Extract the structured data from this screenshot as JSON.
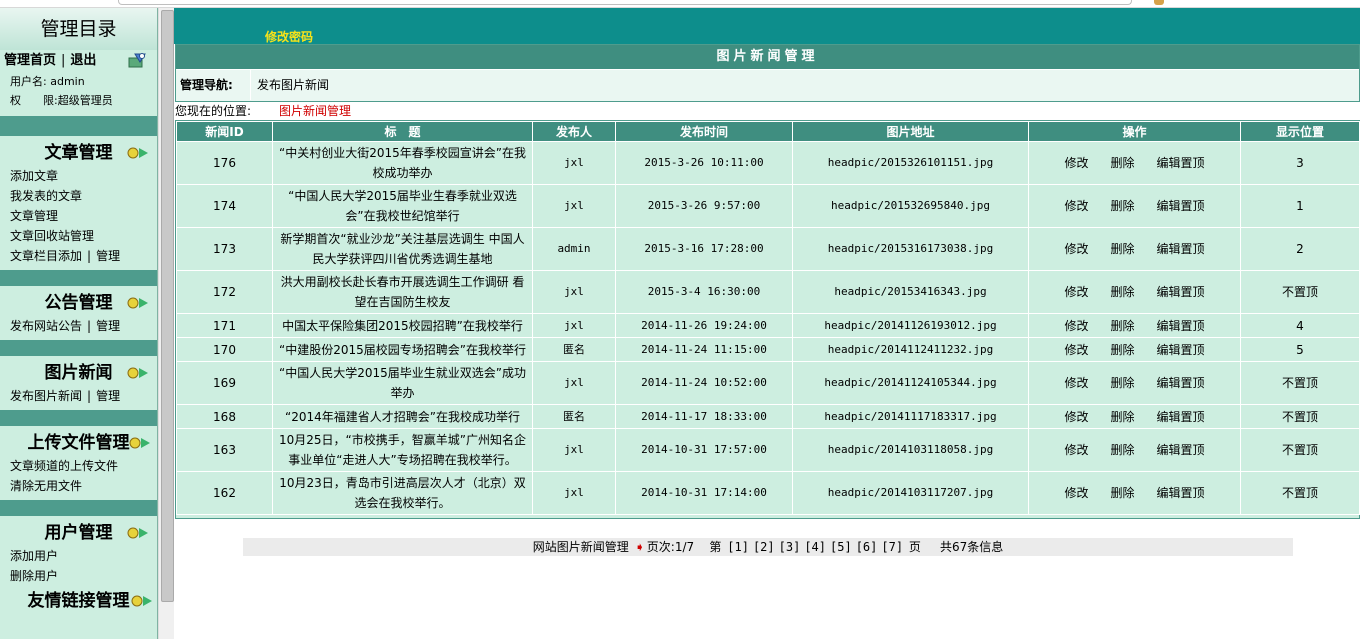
{
  "sidebar": {
    "title": "管理目录",
    "home_link": "管理首页",
    "logout_link": "退出",
    "username_label": "用户名:",
    "username": "admin",
    "role_label": "权　　限:",
    "role": "超级管理员",
    "sections": [
      {
        "title": "文章管理",
        "links": [
          "添加文章",
          "我发表的文章",
          "文章管理",
          "文章回收站管理"
        ],
        "pair": [
          "文章栏目添加",
          "管理"
        ]
      },
      {
        "title": "公告管理",
        "links": [],
        "pair": [
          "发布网站公告",
          "管理"
        ]
      },
      {
        "title": "图片新闻",
        "links": [],
        "pair": [
          "发布图片新闻",
          "管理"
        ]
      },
      {
        "title": "上传文件管理",
        "links": [
          "文章频道的上传文件",
          "清除无用文件"
        ],
        "pair": null
      },
      {
        "title": "用户管理",
        "links": [
          "添加用户",
          "删除用户"
        ],
        "pair": null
      },
      {
        "title": "友情链接管理",
        "links": [],
        "pair": null
      }
    ]
  },
  "topbar": {
    "change_password": "修改密码"
  },
  "panel": {
    "title": "图片新闻管理",
    "nav_label": "管理导航:",
    "nav_value": "发布图片新闻"
  },
  "location": {
    "label": "您现在的位置:",
    "current": "图片新闻管理"
  },
  "table": {
    "columns": [
      "新闻ID",
      "标　题",
      "发布人",
      "发布时间",
      "图片地址",
      "操作",
      "显示位置"
    ],
    "actions": [
      "修改",
      "删除",
      "编辑置顶"
    ],
    "rows": [
      {
        "id": "176",
        "title": "“中关村创业大街2015年春季校园宣讲会”在我校成功举办",
        "author": "jxl",
        "time": "2015-3-26 10:11:00",
        "pic": "headpic/2015326101151.jpg",
        "pos": "3"
      },
      {
        "id": "174",
        "title": "“中国人民大学2015届毕业生春季就业双选会”在我校世纪馆举行",
        "author": "jxl",
        "time": "2015-3-26 9:57:00",
        "pic": "headpic/201532695840.jpg",
        "pos": "1"
      },
      {
        "id": "173",
        "title": "新学期首次“就业沙龙”关注基层选调生 中国人民大学获评四川省优秀选调生基地",
        "author": "admin",
        "time": "2015-3-16 17:28:00",
        "pic": "headpic/2015316173038.jpg",
        "pos": "2"
      },
      {
        "id": "172",
        "title": "洪大用副校长赴长春市开展选调生工作调研 看望在吉国防生校友",
        "author": "jxl",
        "time": "2015-3-4 16:30:00",
        "pic": "headpic/20153416343.jpg",
        "pos": "不置顶"
      },
      {
        "id": "171",
        "title": "中国太平保险集团2015校园招聘”在我校举行",
        "author": "jxl",
        "time": "2014-11-26 19:24:00",
        "pic": "headpic/20141126193012.jpg",
        "pos": "4"
      },
      {
        "id": "170",
        "title": "“中建股份2015届校园专场招聘会”在我校举行",
        "author": "匿名",
        "time": "2014-11-24 11:15:00",
        "pic": "headpic/2014112411232.jpg",
        "pos": "5"
      },
      {
        "id": "169",
        "title": "“中国人民大学2015届毕业生就业双选会”成功举办",
        "author": "jxl",
        "time": "2014-11-24 10:52:00",
        "pic": "headpic/20141124105344.jpg",
        "pos": "不置顶"
      },
      {
        "id": "168",
        "title": "“2014年福建省人才招聘会”在我校成功举行",
        "author": "匿名",
        "time": "2014-11-17 18:33:00",
        "pic": "headpic/20141117183317.jpg",
        "pos": "不置顶"
      },
      {
        "id": "163",
        "title": "10月25日，“市校携手，智赢羊城”广州知名企事业单位“走进人大”专场招聘在我校举行。",
        "author": "jxl",
        "time": "2014-10-31 17:57:00",
        "pic": "headpic/2014103118058.jpg",
        "pos": "不置顶"
      },
      {
        "id": "162",
        "title": "10月23日，青岛市引进高层次人才（北京）双选会在我校举行。",
        "author": "jxl",
        "time": "2014-10-31 17:14:00",
        "pic": "headpic/2014103117207.jpg",
        "pos": "不置顶"
      }
    ]
  },
  "pager": {
    "label": "网站图片新闻管理",
    "page_info": "页次:1/7",
    "prefix": "第",
    "pages": [
      "[1]",
      "[2]",
      "[3]",
      "[4]",
      "[5]",
      "[6]",
      "[7]"
    ],
    "suffix": "页",
    "total": "共67条信息"
  }
}
